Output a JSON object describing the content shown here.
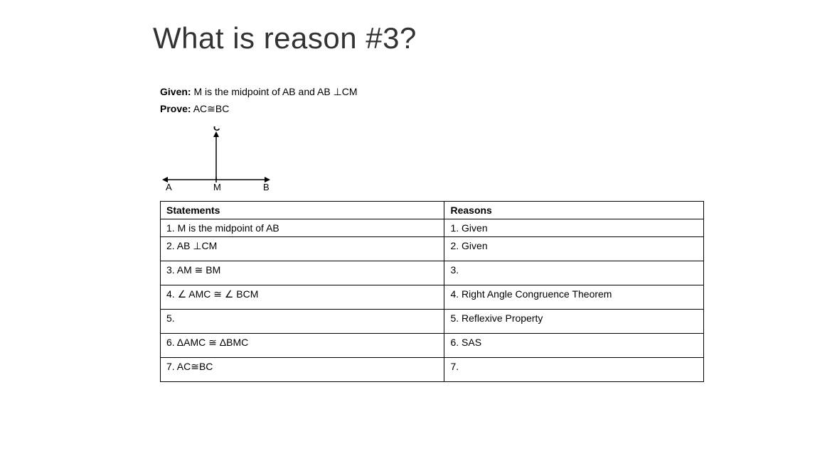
{
  "title": "What is reason #3?",
  "given": {
    "label": "Given:",
    "text": "M is the midpoint of AB and AB ⊥CM"
  },
  "prove": {
    "label": "Prove:",
    "text": "AC≅BC"
  },
  "diagram": {
    "point_a": "A",
    "point_m": "M",
    "point_b": "B",
    "point_c": "C"
  },
  "headers": {
    "statements": "Statements",
    "reasons": "Reasons"
  },
  "rows": [
    {
      "s": "1.  M is the midpoint of AB",
      "r": "1. Given"
    },
    {
      "s": "2.  AB ⊥CM",
      "r": "2. Given"
    },
    {
      "s": "3.  AM ≅ BM",
      "r": "3."
    },
    {
      "s": "4. ∠ AMC ≅ ∠ BCM",
      "r": "4.  Right Angle Congruence Theorem"
    },
    {
      "s": "5.",
      "r": "5. Reflexive Property"
    },
    {
      "s": "6.   ΔAMC ≅ ΔBMC",
      "r": "6. SAS"
    },
    {
      "s": "7. AC≅BC",
      "r": "7."
    }
  ]
}
